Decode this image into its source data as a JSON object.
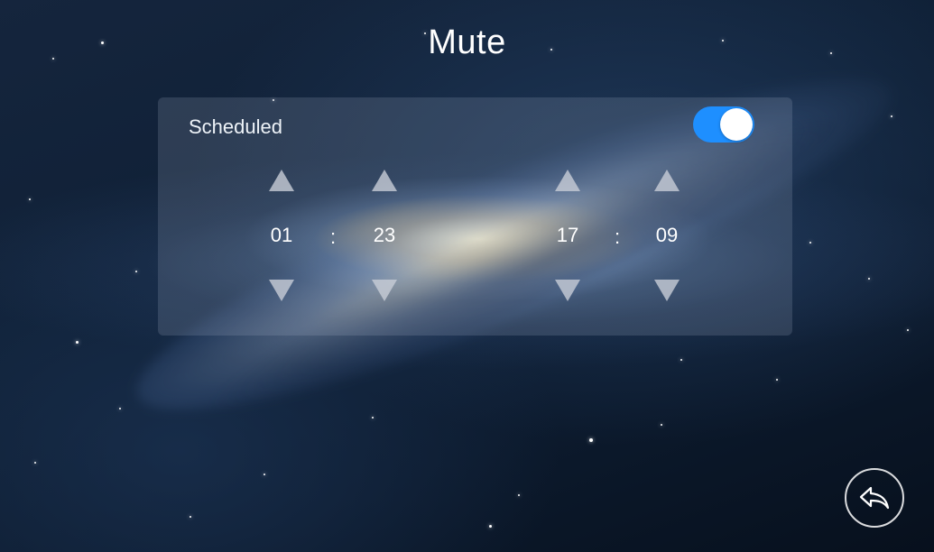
{
  "title": "Mute",
  "schedule": {
    "label": "Scheduled",
    "enabled": true,
    "toggle_color": "#1e8fff"
  },
  "time_fields": [
    {
      "value": "01"
    },
    {
      "value": "23"
    },
    {
      "value": "17"
    },
    {
      "value": "09"
    }
  ],
  "separator": ":",
  "icons": {
    "increment": "triangle-up-icon",
    "decrement": "triangle-down-icon",
    "back": "back-arrow-icon"
  }
}
